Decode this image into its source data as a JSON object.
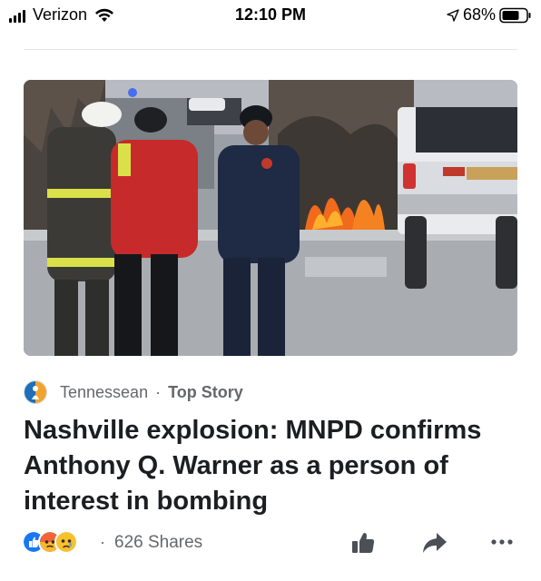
{
  "status_bar": {
    "carrier": "Verizon",
    "time": "12:10 PM",
    "battery_percent": "68%",
    "icons": [
      "signal-bars-icon",
      "wifi-icon",
      "location-arrow-icon",
      "battery-icon"
    ]
  },
  "post": {
    "image_icon": "news-photo",
    "source": {
      "name": "Tennessean",
      "separator": "·",
      "tag": "Top Story",
      "logo_icon": "tennessean-logo-icon"
    },
    "headline": "Nashville explosion: MNPD confirms Anthony Q. Warner as a person of interest in bombing",
    "footer": {
      "reactions": [
        "like-reaction-icon",
        "angry-reaction-icon",
        "sad-reaction-icon"
      ],
      "separator": "·",
      "shares": "626 Shares",
      "actions": [
        "like-icon",
        "share-icon",
        "more-icon"
      ]
    }
  },
  "colors": {
    "text_primary": "#1c1e21",
    "text_secondary": "#65676b",
    "like_blue": "#1877f2",
    "angry_orange": "#f0643a",
    "sad_yellow": "#f7c02d",
    "action_gray": "#4b4f56"
  }
}
